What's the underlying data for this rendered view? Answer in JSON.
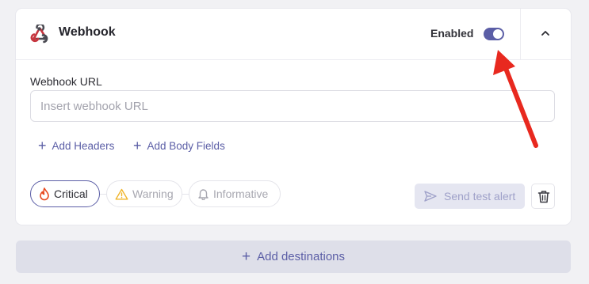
{
  "card": {
    "title": "Webhook",
    "enabled_label": "Enabled",
    "enabled": true,
    "url_label": "Webhook URL",
    "url_value": "",
    "url_placeholder": "Insert webhook URL",
    "add_headers_label": "Add Headers",
    "add_body_fields_label": "Add Body Fields",
    "severity": [
      {
        "label": "Critical",
        "icon": "flame-icon",
        "selected": true
      },
      {
        "label": "Warning",
        "icon": "warning-triangle-icon",
        "selected": false
      },
      {
        "label": "Informative",
        "icon": "bell-icon",
        "selected": false
      }
    ],
    "send_test_label": "Send test alert"
  },
  "add_destinations_label": "Add destinations",
  "colors": {
    "accent": "#5b5ea6",
    "annotation_arrow": "#e8291f",
    "critical_icon": "#e8491f",
    "warning_icon": "#f0b429"
  }
}
